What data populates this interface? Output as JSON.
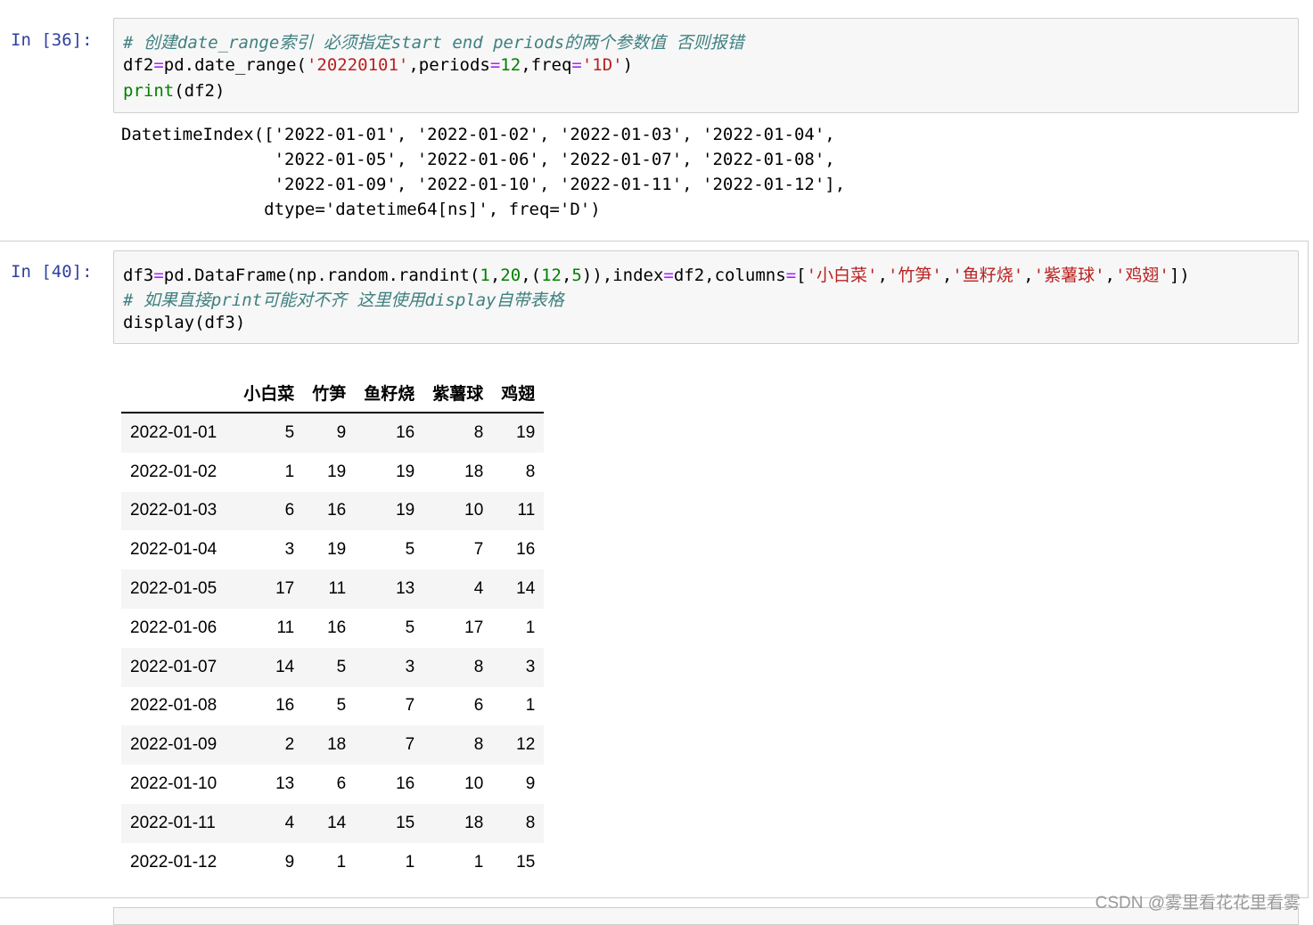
{
  "cell1": {
    "prompt": "In  [36]:",
    "comment": "# 创建date_range索引 必须指定start end periods的两个参数值 否则报错",
    "line2": {
      "a": "df2",
      "eq": "=",
      "b": "pd.date_range(",
      "s1": "'20220101'",
      "c": ",periods",
      "eq2": "=",
      "n1": "12",
      "d": ",freq",
      "eq3": "=",
      "s2": "'1D'",
      "e": ")"
    },
    "line3": {
      "fn": "print",
      "args": "(df2)"
    },
    "output": [
      "DatetimeIndex(['2022-01-01', '2022-01-02', '2022-01-03', '2022-01-04',",
      "               '2022-01-05', '2022-01-06', '2022-01-07', '2022-01-08',",
      "               '2022-01-09', '2022-01-10', '2022-01-11', '2022-01-12'],",
      "              dtype='datetime64[ns]', freq='D')"
    ]
  },
  "cell2": {
    "prompt": "In  [40]:",
    "line1": {
      "a": "df3",
      "eq": "=",
      "b": "pd.DataFrame(np.random.randint(",
      "n1": "1",
      "c1": ",",
      "n2": "20",
      "c2": ",(",
      "n3": "12",
      "c3": ",",
      "n4": "5",
      "c4": ")),index",
      "eq2": "=",
      "c5": "df2,columns",
      "eq3": "=",
      "c6": "[",
      "s1": "'小白菜'",
      "c7": ",",
      "s2": "'竹笋'",
      "c8": ",",
      "s3": "'鱼籽烧'",
      "c9": ",",
      "s4": "'紫薯球'",
      "c10": ",",
      "s5": "'鸡翅'",
      "c11": "])"
    },
    "comment": "# 如果直接print可能对不齐 这里使用display自带表格",
    "line3": {
      "fn": "display",
      "args": "(df3)"
    }
  },
  "table": {
    "columns": [
      "小白菜",
      "竹笋",
      "鱼籽烧",
      "紫薯球",
      "鸡翅"
    ],
    "rows": [
      {
        "index": "2022-01-01",
        "values": [
          "5",
          "9",
          "16",
          "8",
          "19"
        ]
      },
      {
        "index": "2022-01-02",
        "values": [
          "1",
          "19",
          "19",
          "18",
          "8"
        ]
      },
      {
        "index": "2022-01-03",
        "values": [
          "6",
          "16",
          "19",
          "10",
          "11"
        ]
      },
      {
        "index": "2022-01-04",
        "values": [
          "3",
          "19",
          "5",
          "7",
          "16"
        ]
      },
      {
        "index": "2022-01-05",
        "values": [
          "17",
          "11",
          "13",
          "4",
          "14"
        ]
      },
      {
        "index": "2022-01-06",
        "values": [
          "11",
          "16",
          "5",
          "17",
          "1"
        ]
      },
      {
        "index": "2022-01-07",
        "values": [
          "14",
          "5",
          "3",
          "8",
          "3"
        ]
      },
      {
        "index": "2022-01-08",
        "values": [
          "16",
          "5",
          "7",
          "6",
          "1"
        ]
      },
      {
        "index": "2022-01-09",
        "values": [
          "2",
          "18",
          "7",
          "8",
          "12"
        ]
      },
      {
        "index": "2022-01-10",
        "values": [
          "13",
          "6",
          "16",
          "10",
          "9"
        ]
      },
      {
        "index": "2022-01-11",
        "values": [
          "4",
          "14",
          "15",
          "18",
          "8"
        ]
      },
      {
        "index": "2022-01-12",
        "values": [
          "9",
          "1",
          "1",
          "1",
          "15"
        ]
      }
    ]
  },
  "watermark": "CSDN @雾里看花花里看雾"
}
